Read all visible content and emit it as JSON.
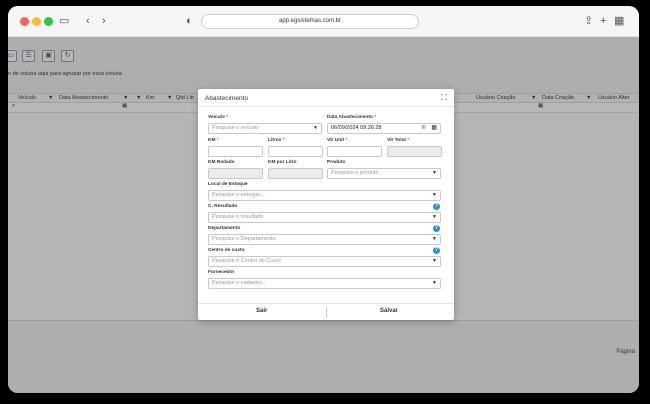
{
  "browser": {
    "url": "app.egsistemas.com.br",
    "colors": {
      "close": "#ff5f57",
      "minimize": "#febc2e",
      "zoom": "#28c840"
    }
  },
  "grid": {
    "group_hint": "n de coluna aqui para agrupar por essa coluna",
    "columns": [
      "Veículo",
      "Data Abastecimento",
      "Km",
      "Qtd Litr",
      "Usuário Criação",
      "Data Criação",
      "Usuário Alter"
    ],
    "pager_label": "Página"
  },
  "modal": {
    "title": "Abastecimento",
    "fields": {
      "veiculo": {
        "label": "Veículo",
        "placeholder": "Pesquise o veículo"
      },
      "data_abastecimento": {
        "label": "Data Abastecimento",
        "value": "06/09/2024 09:26:28"
      },
      "km": {
        "label": "KM"
      },
      "litros": {
        "label": "Litros"
      },
      "vlr_unit": {
        "label": "Vlr Unit"
      },
      "vlr_total": {
        "label": "Vlr Total"
      },
      "km_rodado": {
        "label": "KM Rodado"
      },
      "km_por_litro": {
        "label": "KM por Litro"
      },
      "produto": {
        "label": "Produto",
        "placeholder": "Pesquise o produto"
      },
      "local_estoque": {
        "label": "Local de Estoque",
        "placeholder": "Pesquise o estoque..."
      },
      "c_resultado": {
        "label": "C. Resultado",
        "placeholder": "Pesquise o resultado"
      },
      "departamento": {
        "label": "Departamento",
        "placeholder": "Pesquise o Departamento"
      },
      "centro_custo": {
        "label": "Centro de custo",
        "placeholder": "Pesquise o Centro de Custo"
      },
      "fornecedor": {
        "label": "Fornecedor",
        "placeholder": "Pesquise o cadastro..."
      }
    },
    "buttons": {
      "exit": "Sair",
      "save": "Salvar"
    },
    "required_mark": "*",
    "help_mark": "?"
  }
}
